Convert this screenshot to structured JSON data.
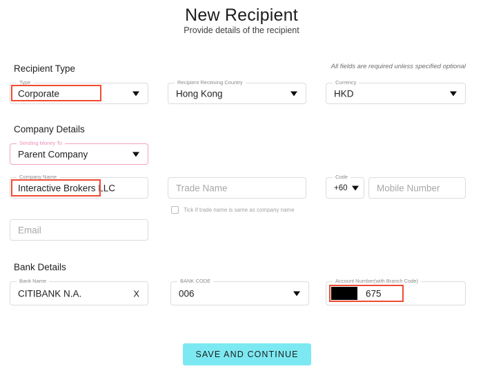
{
  "header": {
    "title": "New Recipient",
    "subtitle": "Provide details of the recipient"
  },
  "note": "All fields are required unless specified optional",
  "sections": {
    "recipient_type": {
      "heading": "Recipient Type",
      "type": {
        "label": "Type",
        "value": "Corporate"
      },
      "country": {
        "label": "Recipient Receiving Country",
        "value": "Hong Kong"
      },
      "currency": {
        "label": "Currency",
        "value": "HKD"
      }
    },
    "company_details": {
      "heading": "Company Details",
      "sending_money_to": {
        "label": "Sending Money To",
        "value": "Parent Company"
      },
      "company_name": {
        "label": "Company Name",
        "value": "Interactive Brokers LLC"
      },
      "trade_name": {
        "placeholder": "Trade Name",
        "value": ""
      },
      "trade_name_checkbox": {
        "label": "Tick if trade name is same as company name",
        "checked": false
      },
      "code": {
        "label": "Code",
        "value": "+60"
      },
      "mobile_number": {
        "placeholder": "Mobile Number",
        "value": ""
      },
      "email": {
        "placeholder": "Email",
        "value": ""
      }
    },
    "bank_details": {
      "heading": "Bank Details",
      "bank_name": {
        "label": "Bank Name",
        "value": "CITIBANK N.A.",
        "clear": "X"
      },
      "bank_code": {
        "label": "BANK CODE",
        "value": "006"
      },
      "account_number": {
        "label": "Account Number(with Branch Code)",
        "value": "675"
      }
    }
  },
  "submit": {
    "label": "SAVE AND CONTINUE"
  },
  "colors": {
    "accent": "#7ce9f2",
    "annotation": "#f04a30",
    "focus_pink": "#ef8cb6"
  }
}
